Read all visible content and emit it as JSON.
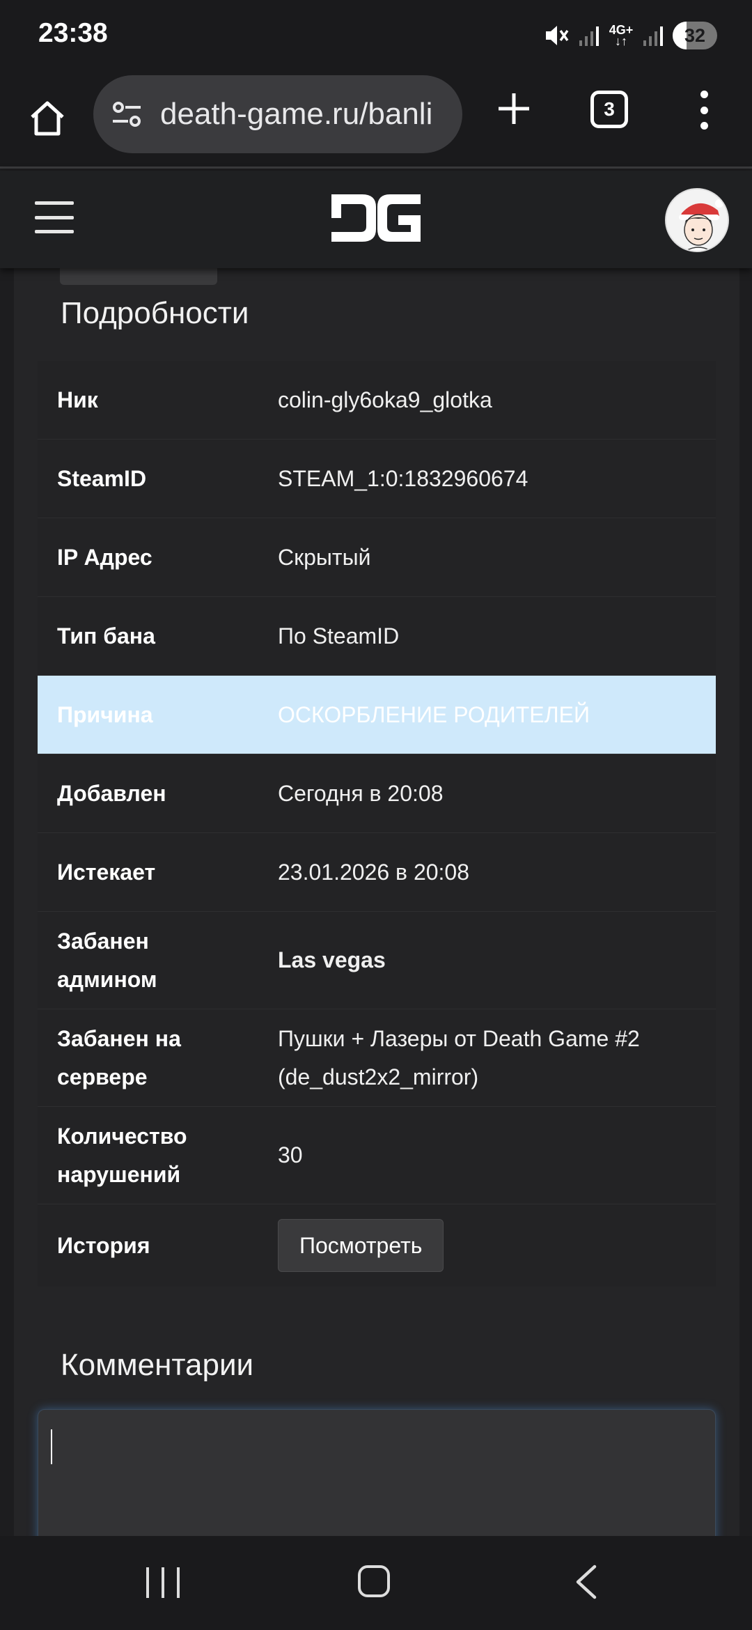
{
  "status_bar": {
    "time": "23:38",
    "network": "4G+",
    "battery": "32"
  },
  "browser": {
    "url": "death-game.ru/banli",
    "tab_count": "3"
  },
  "site": {
    "logo_text": "DG"
  },
  "details": {
    "title": "Подробности",
    "rows": [
      {
        "label": "Ник",
        "value": "colin-gly6oka9_glotka"
      },
      {
        "label": "SteamID",
        "value": "STEAM_1:0:1832960674"
      },
      {
        "label": "IP Адрес",
        "value": "Скрытый"
      },
      {
        "label": "Тип бана",
        "value": "По SteamID"
      },
      {
        "label": "Причина",
        "value": "ОСКОРБЛЕНИЕ РОДИТЕЛЕЙ"
      },
      {
        "label": "Добавлен",
        "value": "Сегодня в 20:08"
      },
      {
        "label": "Истекает",
        "value": "23.01.2026 в 20:08"
      },
      {
        "label": "Забанен админом",
        "value": "Las vegas"
      },
      {
        "label": "Забанен на сервере",
        "value": "Пушки + Лазеры от Death Game #2 (de_dust2x2_mirror)"
      },
      {
        "label": "Количество нарушений",
        "value": "30"
      },
      {
        "label": "История",
        "button": "Посмотреть"
      }
    ]
  },
  "comments": {
    "title": "Комментарии",
    "input_value": ""
  },
  "colors": {
    "highlight_row": "#cfe9fb",
    "background": "#252527"
  }
}
